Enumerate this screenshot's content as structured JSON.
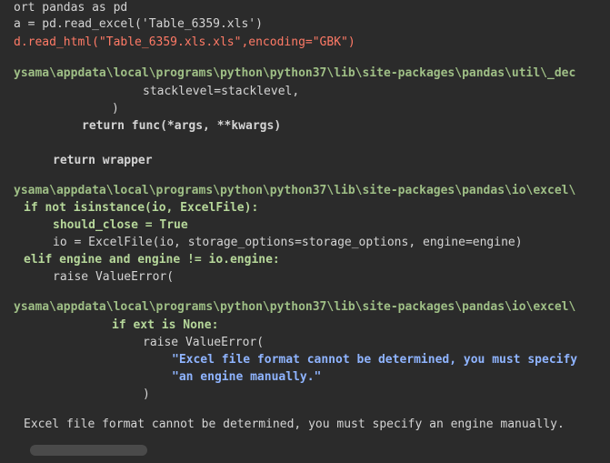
{
  "lines": [
    "ort pandas as pd",
    "a = pd.read_excel('Table_6359.xls')",
    "d.read_html(\"Table_6359.xls.xls\",encoding=\"GBK\")",
    "",
    "ysama\\appdata\\local\\programs\\python\\python37\\lib\\site-packages\\pandas\\util\\_dec",
    "stacklevel=stacklevel,",
    ")",
    "return func(*args, **kwargs)",
    "",
    "return wrapper",
    "",
    "ysama\\appdata\\local\\programs\\python\\python37\\lib\\site-packages\\pandas\\io\\excel\\",
    "if not isinstance(io, ExcelFile):",
    "should_close = True",
    "io = ExcelFile(io, storage_options=storage_options, engine=engine)",
    "elif engine and engine != io.engine:",
    "raise ValueError(",
    "",
    "ysama\\appdata\\local\\programs\\python\\python37\\lib\\site-packages\\pandas\\io\\excel\\",
    "if ext is None:",
    "raise ValueError(",
    "\"Excel file format cannot be determined, you must specify",
    "\"an engine manually.\"",
    ")",
    "",
    "Excel file format cannot be determined, you must specify an engine manually."
  ]
}
